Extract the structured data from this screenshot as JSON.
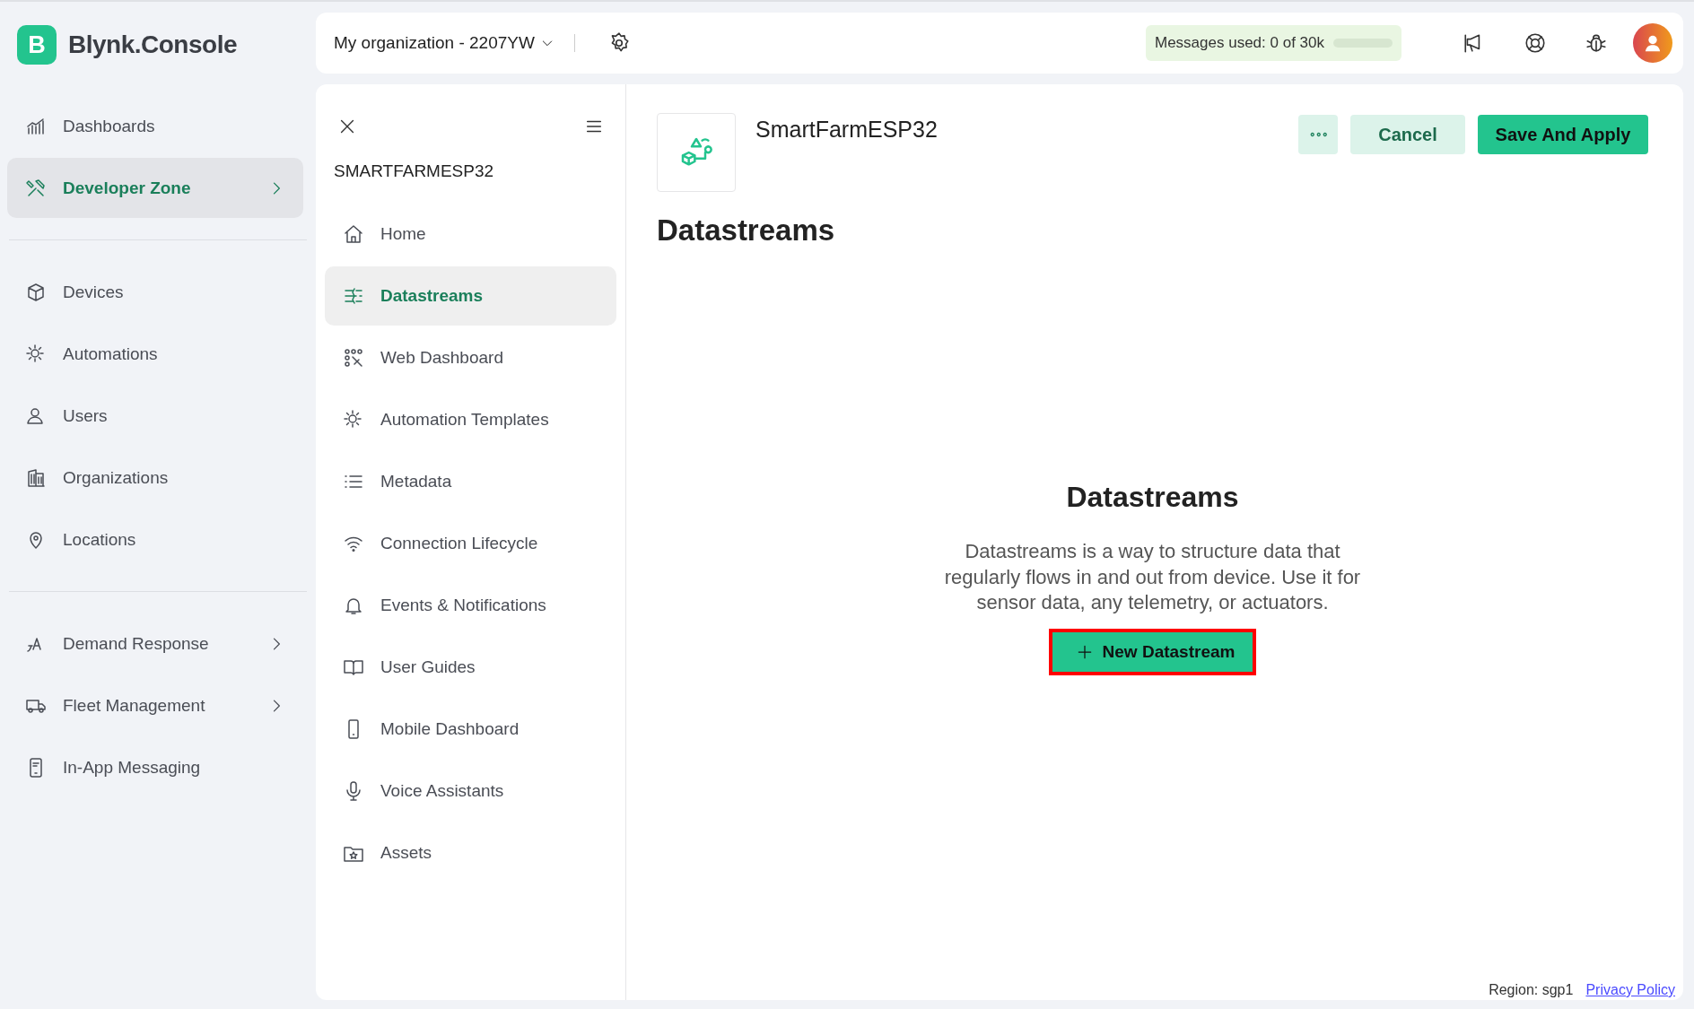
{
  "brand": {
    "logo_letter": "B",
    "name": "Blynk.Console"
  },
  "sidebar": {
    "groups": [
      {
        "items": [
          {
            "label": "Dashboards",
            "selected": false,
            "submenu": false
          },
          {
            "label": "Developer Zone",
            "selected": true,
            "submenu": true
          }
        ]
      },
      {
        "items": [
          {
            "label": "Devices",
            "selected": false,
            "submenu": false
          },
          {
            "label": "Automations",
            "selected": false,
            "submenu": false
          },
          {
            "label": "Users",
            "selected": false,
            "submenu": false
          },
          {
            "label": "Organizations",
            "selected": false,
            "submenu": false
          },
          {
            "label": "Locations",
            "selected": false,
            "submenu": false
          }
        ]
      },
      {
        "items": [
          {
            "label": "Demand Response",
            "selected": false,
            "submenu": true
          },
          {
            "label": "Fleet Management",
            "selected": false,
            "submenu": true
          },
          {
            "label": "In-App Messaging",
            "selected": false,
            "submenu": false
          }
        ]
      }
    ]
  },
  "top_bar": {
    "organization": "My organization - 2207YW",
    "messages": {
      "label": "Messages used:",
      "value": "0 of 30k",
      "level": 0
    }
  },
  "template_nav": {
    "title": "SMARTFARMESP32",
    "items": [
      {
        "label": "Home",
        "selected": false
      },
      {
        "label": "Datastreams",
        "selected": true
      },
      {
        "label": "Web Dashboard",
        "selected": false
      },
      {
        "label": "Automation Templates",
        "selected": false
      },
      {
        "label": "Metadata",
        "selected": false
      },
      {
        "label": "Connection Lifecycle",
        "selected": false
      },
      {
        "label": "Events & Notifications",
        "selected": false
      },
      {
        "label": "User Guides",
        "selected": false
      },
      {
        "label": "Mobile Dashboard",
        "selected": false
      },
      {
        "label": "Voice Assistants",
        "selected": false
      },
      {
        "label": "Assets",
        "selected": false
      }
    ]
  },
  "header": {
    "template_name": "SmartFarmESP32",
    "buttons": [
      {
        "kind": "more",
        "label": "∘∘∘"
      },
      {
        "kind": "secondary",
        "label": "Cancel"
      },
      {
        "kind": "primary",
        "label": "Save And Apply"
      }
    ]
  },
  "page_title": "Datastreams",
  "empty_state": {
    "title": "Datastreams",
    "text": "Datastreams is a way to structure data that regularly flows in and out from device. Use it for sensor data, any telemetry, or actuators.",
    "button": {
      "label": "New Datastream",
      "highlighted": true
    }
  },
  "footer": {
    "region": "Region: sgp1",
    "link": "Privacy Policy"
  }
}
